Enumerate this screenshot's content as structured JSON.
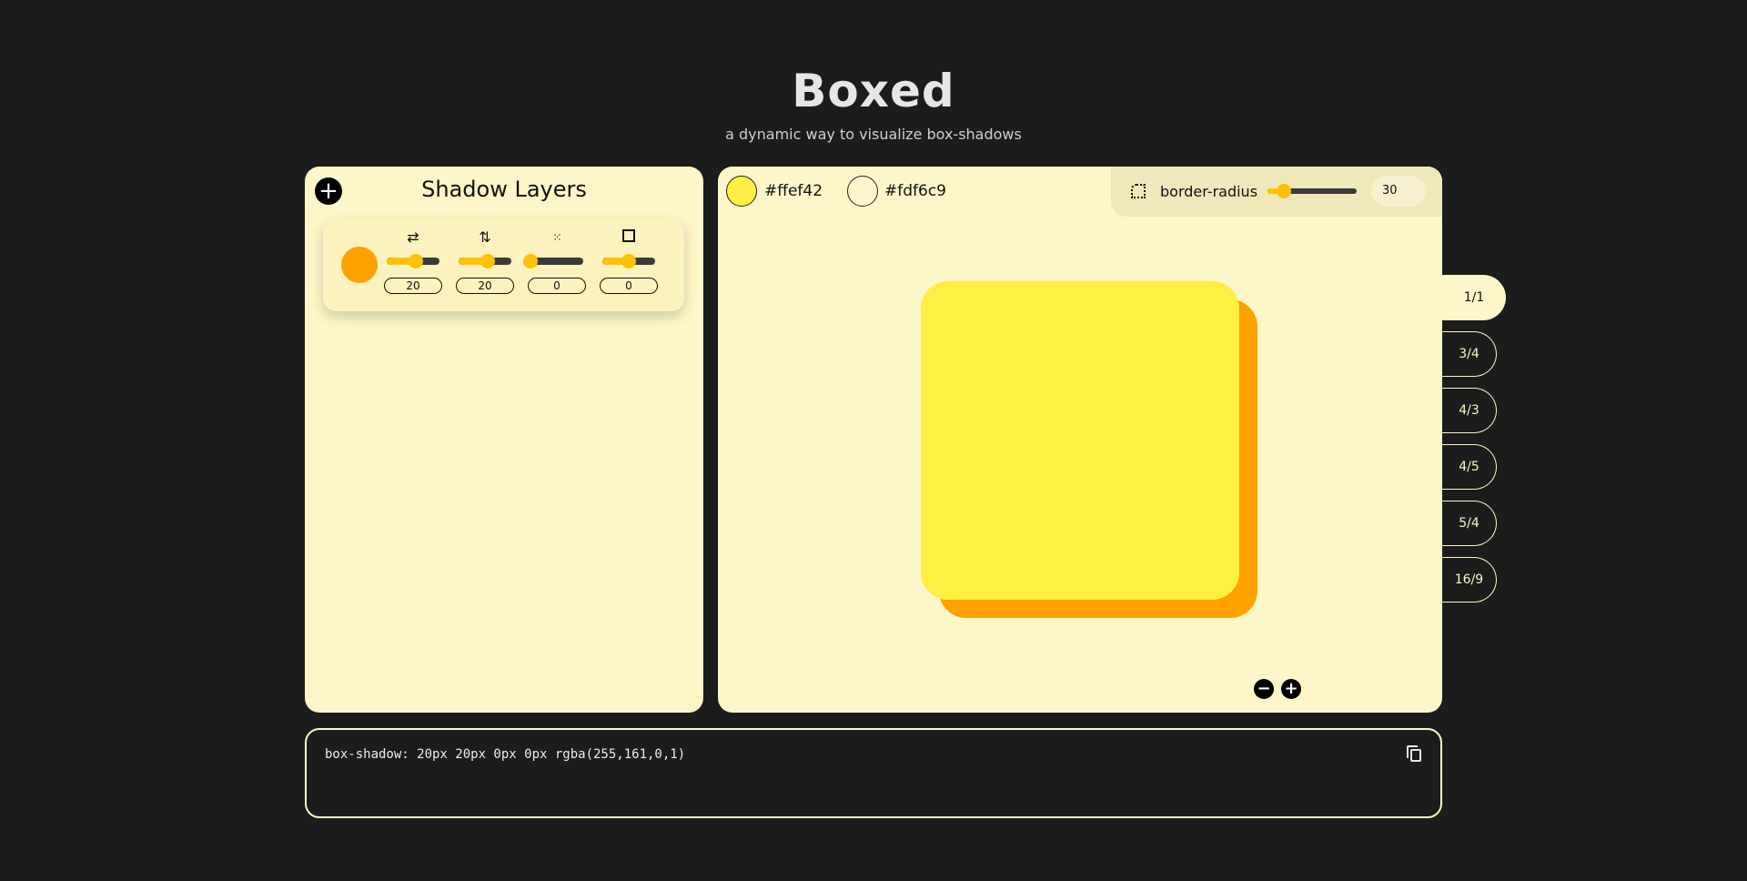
{
  "header": {
    "title": "Boxed",
    "subtitle": "a dynamic way to visualize box-shadows"
  },
  "layers_panel": {
    "title": "Shadow Layers",
    "add_icon": "plus-icon",
    "layers": [
      {
        "color": "#ffa101",
        "controls": [
          {
            "name": "offset-x",
            "icon": "horizontal-arrows-icon",
            "value": "20",
            "slider_fraction": 0.55
          },
          {
            "name": "offset-y",
            "icon": "vertical-arrows-icon",
            "value": "20",
            "slider_fraction": 0.55
          },
          {
            "name": "blur",
            "icon": "blur-dots-icon",
            "value": "0",
            "slider_fraction": 0.0
          },
          {
            "name": "spread",
            "icon": "square-icon",
            "value": "0",
            "slider_fraction": 0.5
          }
        ]
      }
    ]
  },
  "preview": {
    "box_color": {
      "hex": "#ffef42",
      "label": "#ffef42"
    },
    "background_color": {
      "hex": "#fdf6c9",
      "label": "#fdf6c9"
    },
    "border_radius": {
      "label": "border-radius",
      "value": "30",
      "slider_fraction": 0.18
    },
    "zoom_out_icon": "minus-icon",
    "zoom_in_icon": "plus-icon"
  },
  "aspect_ratios": {
    "items": [
      "1/1",
      "3/4",
      "4/3",
      "4/5",
      "5/4",
      "16/9"
    ],
    "active": "1/1"
  },
  "code": {
    "text": "box-shadow: 20px 20px 0px 0px rgba(255,161,0,1)",
    "copy_icon": "copy-icon"
  }
}
